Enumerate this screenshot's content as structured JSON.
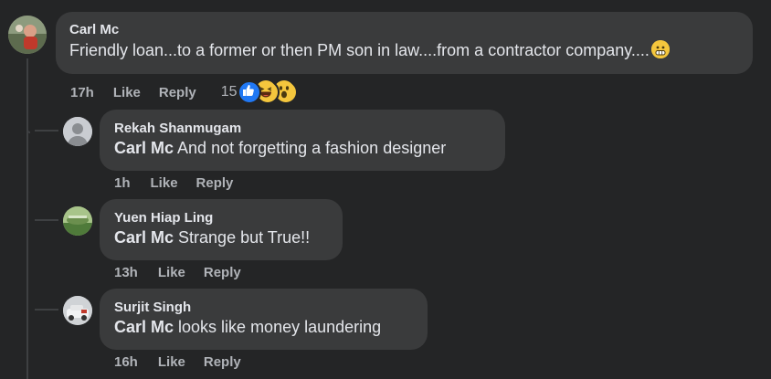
{
  "comments": [
    {
      "author": "Carl Mc",
      "text": "Friendly loan...to a former or then PM son in law....from a contractor company....",
      "time": "17h",
      "like": "Like",
      "reply": "Reply",
      "reaction_count": "15"
    },
    {
      "author": "Rekah Shanmugam",
      "mention": "Carl Mc",
      "text": " And not forgetting a fashion designer",
      "time": "1h",
      "like": "Like",
      "reply": "Reply"
    },
    {
      "author": "Yuen Hiap Ling",
      "mention": "Carl Mc",
      "text": " Strange but True!!",
      "time": "13h",
      "like": "Like",
      "reply": "Reply"
    },
    {
      "author": "Surjit Singh",
      "mention": "Carl Mc",
      "text": " looks like money laundering",
      "time": "16h",
      "like": "Like",
      "reply": "Reply"
    }
  ],
  "icons": {
    "main_emoji": "grimace-emoji-icon",
    "reactions": [
      "like-reaction-icon",
      "haha-reaction-icon",
      "wow-reaction-icon"
    ]
  },
  "colors": {
    "background": "#242526",
    "bubble": "#3a3b3c",
    "like_blue": "#2078f4",
    "emoji_yellow": "#f4c63d"
  }
}
